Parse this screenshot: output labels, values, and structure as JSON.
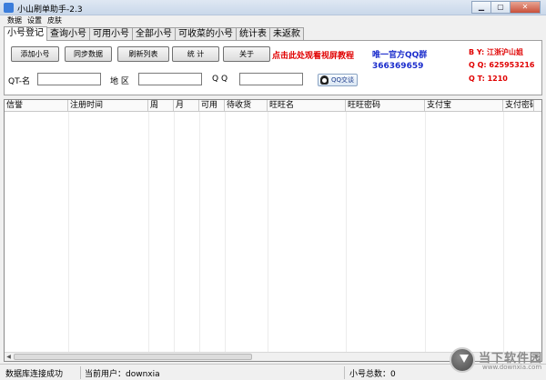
{
  "window": {
    "title": "小山刷单助手-2.3",
    "controls": [
      "▁",
      "▢",
      "✕"
    ]
  },
  "menu": [
    "数据",
    "设置",
    "皮肤"
  ],
  "tabs": [
    "小号登记",
    "查询小号",
    "可用小号",
    "全部小号",
    "可收菜的小号",
    "统计表",
    "未返款"
  ],
  "active_tab": 0,
  "toolbar": {
    "add": "添加小号",
    "sync": "同步数据",
    "refresh": "刷新列表",
    "stats": "统 计",
    "about": "关于"
  },
  "promo_link": "点击此处观看视屏教程",
  "qq_group": {
    "label": "唯一官方QQ群",
    "number": "366369659"
  },
  "author": {
    "by": "B Y: 江浙沪山姐",
    "qq": "Q Q: 625953216",
    "qt": "Q T: 1210"
  },
  "fields": {
    "qt_name_label": "QT-名",
    "region_label": "地 区",
    "qq_label": "Q Q",
    "qt_name_value": "",
    "region_value": "",
    "qq_value": ""
  },
  "qq_talk_button": "QQ交谈",
  "table": {
    "columns": [
      "信誉",
      "注册时间",
      "周",
      "月",
      "可用",
      "待收货",
      "旺旺名",
      "旺旺密码",
      "支付宝",
      "支付密码"
    ],
    "rows": []
  },
  "status": {
    "db": "数据库连接成功",
    "user": "当前用户：downxia",
    "count": "小号总数：0"
  },
  "watermark": {
    "name": "当下软件园",
    "url": "www.downxia.com"
  },
  "colors": {
    "promo": "#e00000",
    "qq_group": "#1a2ccc",
    "author": "#e00000"
  }
}
